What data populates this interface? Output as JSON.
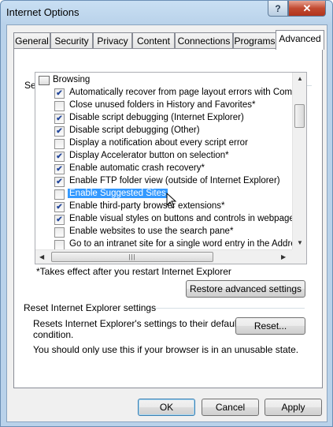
{
  "window": {
    "title": "Internet Options",
    "help_glyph": "?",
    "close_glyph": "✕"
  },
  "tabs": [
    {
      "label": "General"
    },
    {
      "label": "Security"
    },
    {
      "label": "Privacy"
    },
    {
      "label": "Content"
    },
    {
      "label": "Connections"
    },
    {
      "label": "Programs"
    },
    {
      "label": "Advanced",
      "active": true
    }
  ],
  "settings": {
    "group_label": "Settings",
    "category": "Browsing",
    "items": [
      {
        "label": "Automatically recover from page layout errors with Compa",
        "checked": true
      },
      {
        "label": "Close unused folders in History and Favorites*",
        "checked": false
      },
      {
        "label": "Disable script debugging (Internet Explorer)",
        "checked": true
      },
      {
        "label": "Disable script debugging (Other)",
        "checked": true
      },
      {
        "label": "Display a notification about every script error",
        "checked": false
      },
      {
        "label": "Display Accelerator button on selection*",
        "checked": true
      },
      {
        "label": "Enable automatic crash recovery*",
        "checked": true
      },
      {
        "label": "Enable FTP folder view (outside of Internet Explorer)",
        "checked": true
      },
      {
        "label": "Enable Suggested Sites",
        "checked": false,
        "selected": true
      },
      {
        "label": "Enable third-party browser extensions*",
        "checked": true
      },
      {
        "label": "Enable visual styles on buttons and controls in webpages",
        "checked": true
      },
      {
        "label": "Enable websites to use the search pane*",
        "checked": false
      },
      {
        "label": "Go to an intranet site for a single word entry in the Addres",
        "checked": false
      }
    ],
    "footnote": "*Takes effect after you restart Internet Explorer",
    "restore_button": "Restore advanced settings",
    "hscroll_grip": "|||"
  },
  "reset": {
    "group_label": "Reset Internet Explorer settings",
    "description_line1": "Resets Internet Explorer's settings to their default",
    "description_line2": "condition.",
    "reset_button": "Reset...",
    "warning": "You should only use this if your browser is in an unusable state."
  },
  "footer": {
    "ok": "OK",
    "cancel": "Cancel",
    "apply": "Apply"
  },
  "icons": {
    "check_glyph": "✔",
    "up_arrow": "▲",
    "down_arrow": "▼",
    "left_arrow": "◀",
    "right_arrow": "▶"
  }
}
